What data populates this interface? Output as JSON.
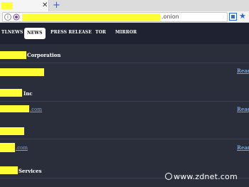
{
  "browser": {
    "tab_close": "✕",
    "new_tab": "+",
    "url_suffix": ".onion",
    "info_icon": "i",
    "bookmark_icon": "★"
  },
  "nav": {
    "items": [
      {
        "label": "TLNEWS"
      },
      {
        "label": "NEWS",
        "active": true
      },
      {
        "label": "PRESS RELEASE"
      },
      {
        "label": "TOR"
      },
      {
        "label": "MIRROR"
      }
    ]
  },
  "entries": [
    {
      "title_suffix": "Corporation",
      "link_suffix": "",
      "read": "Read"
    },
    {
      "title_suffix": "Inc",
      "link_suffix": ".com",
      "read": "Read"
    },
    {
      "title_suffix": "",
      "link_suffix": ".com",
      "read": "Read"
    },
    {
      "title_suffix": "Services",
      "link_suffix": "",
      "read": ""
    }
  ],
  "watermark": {
    "text": "www.zdnet.com"
  },
  "colors": {
    "redaction": "#ffff33",
    "page_bg": "#2a2e3b",
    "nav_bg": "#1f2230",
    "link": "#7aa0d6"
  }
}
